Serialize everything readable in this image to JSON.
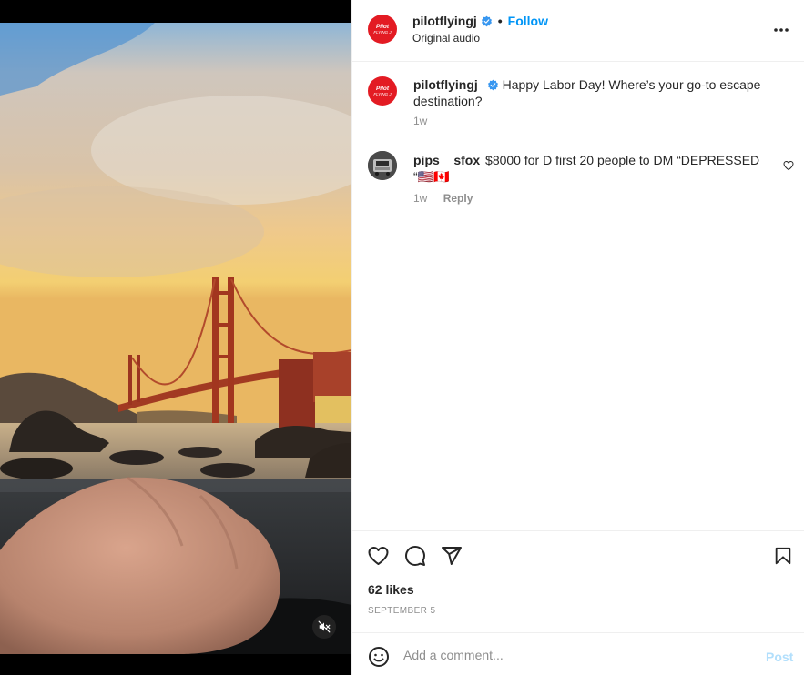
{
  "post": {
    "author": "pilotflyingj",
    "follow_label": "Follow",
    "audio_label": "Original audio",
    "separator": "•",
    "avatar_text_top": "Pilot",
    "avatar_text_bottom": "FLYING J",
    "more_icon": "more-horizontal-icon",
    "verified_icon": "verified-badge-icon"
  },
  "caption": {
    "username": "pilotflyingj",
    "text": "Happy Labor Day! Where’s your go-to escape destination?",
    "time": "1w"
  },
  "comments": [
    {
      "username": "pips__sfox",
      "text": "$8000 for D first 20 people to DM “DEPRESSED “🇺🇸🇨🇦",
      "time": "1w",
      "reply_label": "Reply"
    }
  ],
  "stats": {
    "likes": "62 likes",
    "date": "SEPTEMBER 5"
  },
  "comment_box": {
    "placeholder": "Add a comment...",
    "post_label": "Post"
  },
  "colors": {
    "accent": "#0095f6",
    "brand": "#e31b23",
    "post_disabled": "#b2dffc",
    "muted": "#8e8e8e"
  },
  "icons": {
    "like": "heart-icon",
    "comment": "comment-bubble-icon",
    "share": "paper-plane-icon",
    "save": "bookmark-icon",
    "emoji": "smiley-icon",
    "mute": "speaker-muted-icon"
  }
}
